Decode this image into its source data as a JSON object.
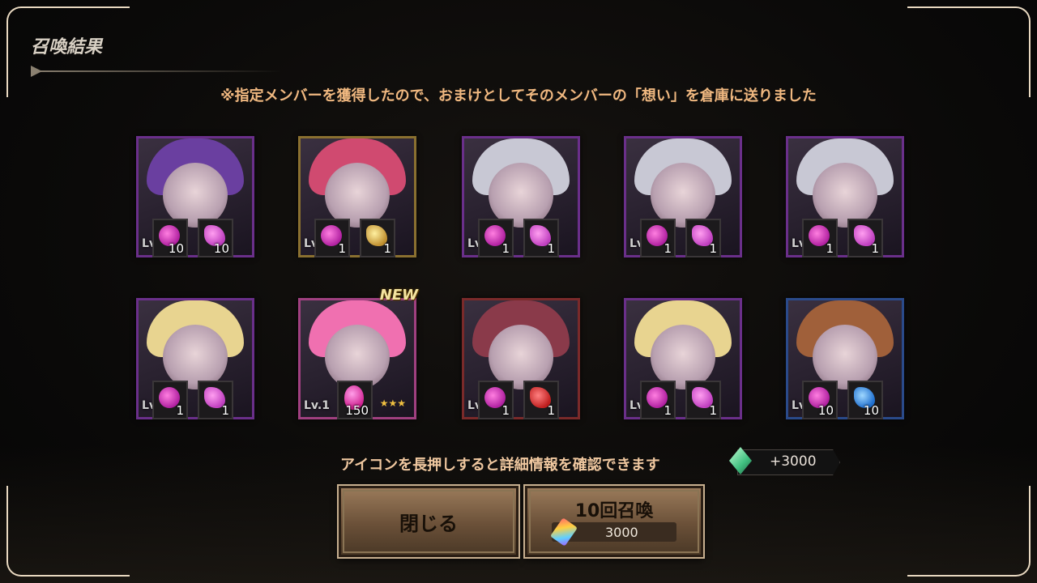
{
  "header": {
    "title": "召喚結果",
    "notice": "※指定メンバーを獲得したので、おまけとしてそのメンバーの「想い」を倉庫に送りました"
  },
  "results": [
    {
      "frame": "purple",
      "level": "Lv",
      "hair": "#6a3fa0",
      "items": [
        {
          "icon": "apple-icon",
          "qty": "10"
        },
        {
          "icon": "soul-pink-icon",
          "qty": "10"
        }
      ]
    },
    {
      "frame": "gold",
      "level": "Lv",
      "hair": "#d04a70",
      "items": [
        {
          "icon": "apple-icon",
          "qty": "1"
        },
        {
          "icon": "soul-gold-icon",
          "qty": "1"
        }
      ]
    },
    {
      "frame": "purple",
      "level": "Lv",
      "hair": "#c8c8d4",
      "items": [
        {
          "icon": "apple-icon",
          "qty": "1"
        },
        {
          "icon": "soul-pink-icon",
          "qty": "1"
        }
      ]
    },
    {
      "frame": "purple",
      "level": "Lv",
      "hair": "#c8c8d4",
      "items": [
        {
          "icon": "apple-icon",
          "qty": "1"
        },
        {
          "icon": "soul-pink-icon",
          "qty": "1"
        }
      ]
    },
    {
      "frame": "purple",
      "level": "Lv",
      "hair": "#c8c8d4",
      "items": [
        {
          "icon": "apple-icon",
          "qty": "1"
        },
        {
          "icon": "soul-pink-icon",
          "qty": "1"
        }
      ]
    },
    {
      "frame": "purple",
      "level": "Lv",
      "hair": "#e8d490",
      "items": [
        {
          "icon": "apple-icon",
          "qty": "1"
        },
        {
          "icon": "soul-pink-icon",
          "qty": "1"
        }
      ]
    },
    {
      "frame": "pink",
      "level": "Lv.1",
      "hair": "#f070b0",
      "badge": "NEW",
      "stars": "★★★",
      "items": [
        {
          "icon": "egg-icon",
          "qty": "150"
        }
      ]
    },
    {
      "frame": "red",
      "level": "Lv",
      "hair": "#8a3a4a",
      "items": [
        {
          "icon": "apple-icon",
          "qty": "1"
        },
        {
          "icon": "soul-red-icon",
          "qty": "1"
        }
      ]
    },
    {
      "frame": "purple",
      "level": "Lv",
      "hair": "#e8d490",
      "items": [
        {
          "icon": "apple-icon",
          "qty": "1"
        },
        {
          "icon": "soul-pink-icon",
          "qty": "1"
        }
      ]
    },
    {
      "frame": "blue",
      "level": "Lv",
      "hair": "#a0603a",
      "items": [
        {
          "icon": "apple-icon",
          "qty": "10"
        },
        {
          "icon": "soul-blue-icon",
          "qty": "10"
        }
      ]
    }
  ],
  "footer": {
    "hint": "アイコンを長押しすると詳細情報を確認できます",
    "gem_bonus": "+3000",
    "gem_icon": "green-gem-icon"
  },
  "buttons": {
    "close_label": "閉じる",
    "summon_label": "10回召喚",
    "summon_cost": "3000",
    "summon_cost_icon": "rainbow-crystal-icon"
  },
  "colors": {
    "notice": "#f0b880",
    "frame_purple": "#6a2f8a",
    "frame_gold": "#8a7030",
    "frame_red": "#7a2a2a",
    "frame_blue": "#2a4a8a",
    "stars": "#f0c040"
  }
}
